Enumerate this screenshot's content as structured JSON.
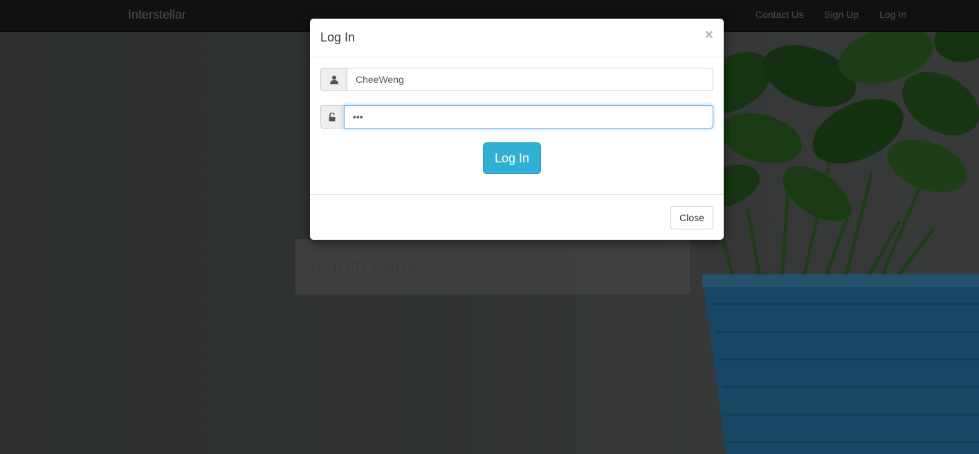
{
  "navbar": {
    "brand": "Interstellar",
    "links": [
      "Contact Us",
      "Sign Up",
      "Log In"
    ]
  },
  "search": {
    "placeholder": "Search hotels"
  },
  "modal": {
    "title": "Log In",
    "close_symbol": "×",
    "username": {
      "value": "CheeWeng",
      "icon": "user-icon"
    },
    "password": {
      "value": "•••",
      "icon": "unlock-icon"
    },
    "submit_label": "Log In",
    "close_label": "Close"
  },
  "colors": {
    "navbar_bg": "#222222",
    "primary_button": "#31b0d5",
    "focus_border": "#66afe9",
    "pot_blue": "#2f8fc8"
  }
}
